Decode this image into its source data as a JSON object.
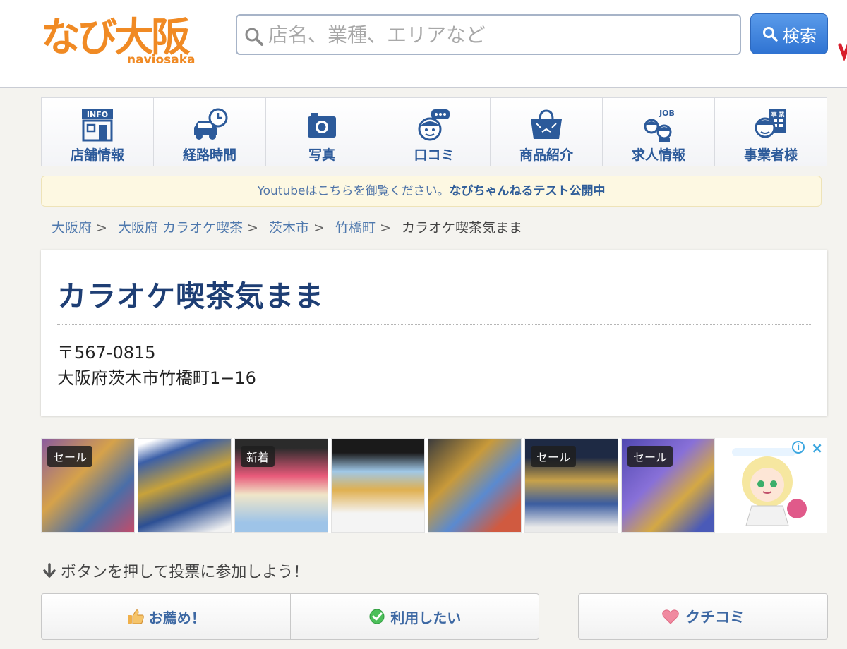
{
  "header": {
    "logo_text": "なび大阪",
    "logo_sub": "naviosaka",
    "search_placeholder": "店名、業種、エリアなど",
    "search_button": "検索"
  },
  "nav": {
    "items": [
      {
        "label": "店舗情報",
        "icon": "info-building-icon"
      },
      {
        "label": "経路時間",
        "icon": "car-clock-icon"
      },
      {
        "label": "写真",
        "icon": "camera-icon"
      },
      {
        "label": "口コミ",
        "icon": "speech-face-icon"
      },
      {
        "label": "商品紹介",
        "icon": "shopping-bag-icon"
      },
      {
        "label": "求人情報",
        "icon": "job-people-icon"
      },
      {
        "label": "事業者様",
        "icon": "business-person-icon"
      }
    ]
  },
  "notice": {
    "text": "Youtubeはこちらを御覧ください。",
    "link": "なびちゃんねるテスト公開中"
  },
  "breadcrumb": {
    "items": [
      "大阪府",
      "大阪府 カラオケ喫茶",
      "茨木市",
      "竹橋町"
    ],
    "current": "カラオケ喫茶気まま",
    "separator": ">"
  },
  "shop": {
    "name": "カラオケ喫茶気まま",
    "postal": "〒567-0815",
    "address": "大阪府茨木市竹橋町1−16"
  },
  "ads": {
    "badges": [
      "セール",
      "",
      "新着",
      "",
      "",
      "セール",
      "セール"
    ]
  },
  "vote": {
    "prompt": "ボタンを押して投票に参加しよう！",
    "recommend": "お薦め！",
    "want_to_use": "利用したい",
    "review": "クチコミ"
  },
  "colors": {
    "nav_text": "#2c5a9a",
    "title": "#1e3e74",
    "link": "#4e78ad",
    "search_button": "#3a82de",
    "logo_orange": "#f08a24"
  }
}
